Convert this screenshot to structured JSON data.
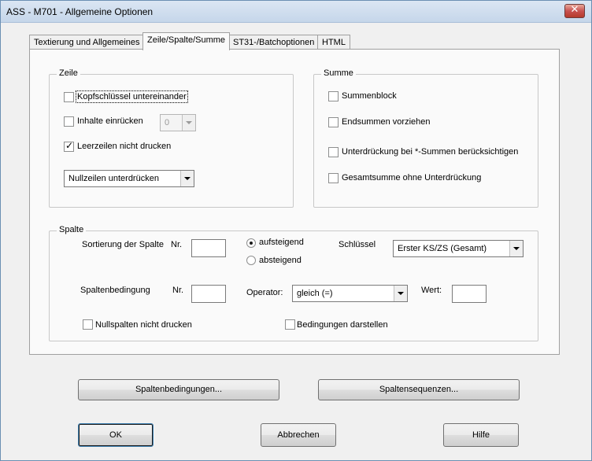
{
  "window": {
    "title": "ASS - M701 - Allgemeine Optionen",
    "close_glyph": "✕"
  },
  "tabs": [
    {
      "label": "Textierung und Allgemeines",
      "active": false
    },
    {
      "label": "Zeile/Spalte/Summe",
      "active": true
    },
    {
      "label": "ST31-/Batchoptionen",
      "active": false
    },
    {
      "label": "HTML",
      "active": false
    }
  ],
  "zeile": {
    "group_label": "Zeile",
    "kopfschluessel_label": "Kopfschlüssel untereinander",
    "kopfschluessel_checked": false,
    "inhalte_label": "Inhalte einrücken",
    "inhalte_checked": false,
    "inhalte_value": "0",
    "leerzeilen_label": "Leerzeilen nicht drucken",
    "leerzeilen_checked": true,
    "nullzeilen_value": "Nullzeilen unterdrücken"
  },
  "summe": {
    "group_label": "Summe",
    "summenblock_label": "Summenblock",
    "endsummen_label": "Endsummen vorziehen",
    "unterdrueckung_label": "Unterdrückung bei *-Summen berücksichtigen",
    "gesamtsumme_label": "Gesamtsumme ohne Unterdrückung"
  },
  "spalte": {
    "group_label": "Spalte",
    "sortierung_label": "Sortierung der Spalte",
    "nr_label": "Nr.",
    "nr_value": "",
    "aufsteigend_label": "aufsteigend",
    "aufsteigend_selected": true,
    "absteigend_label": "absteigend",
    "schluessel_label": "Schlüssel",
    "schluessel_value": "Erster KS/ZS (Gesamt)",
    "bedingung_label": "Spaltenbedingung",
    "nr2_label": "Nr.",
    "nr2_value": "",
    "operator_label": "Operator:",
    "operator_value": "gleich (=)",
    "wert_label": "Wert:",
    "wert_value": "",
    "nullspalten_label": "Nullspalten nicht drucken",
    "bedingungen_darstellen_label": "Bedingungen darstellen"
  },
  "buttons": {
    "spaltenbedingungen": "Spaltenbedingungen...",
    "spaltensequenzen": "Spaltensequenzen...",
    "ok": "OK",
    "abbrechen": "Abbrechen",
    "hilfe": "Hilfe"
  },
  "icons": {
    "checkmark": "✓"
  }
}
